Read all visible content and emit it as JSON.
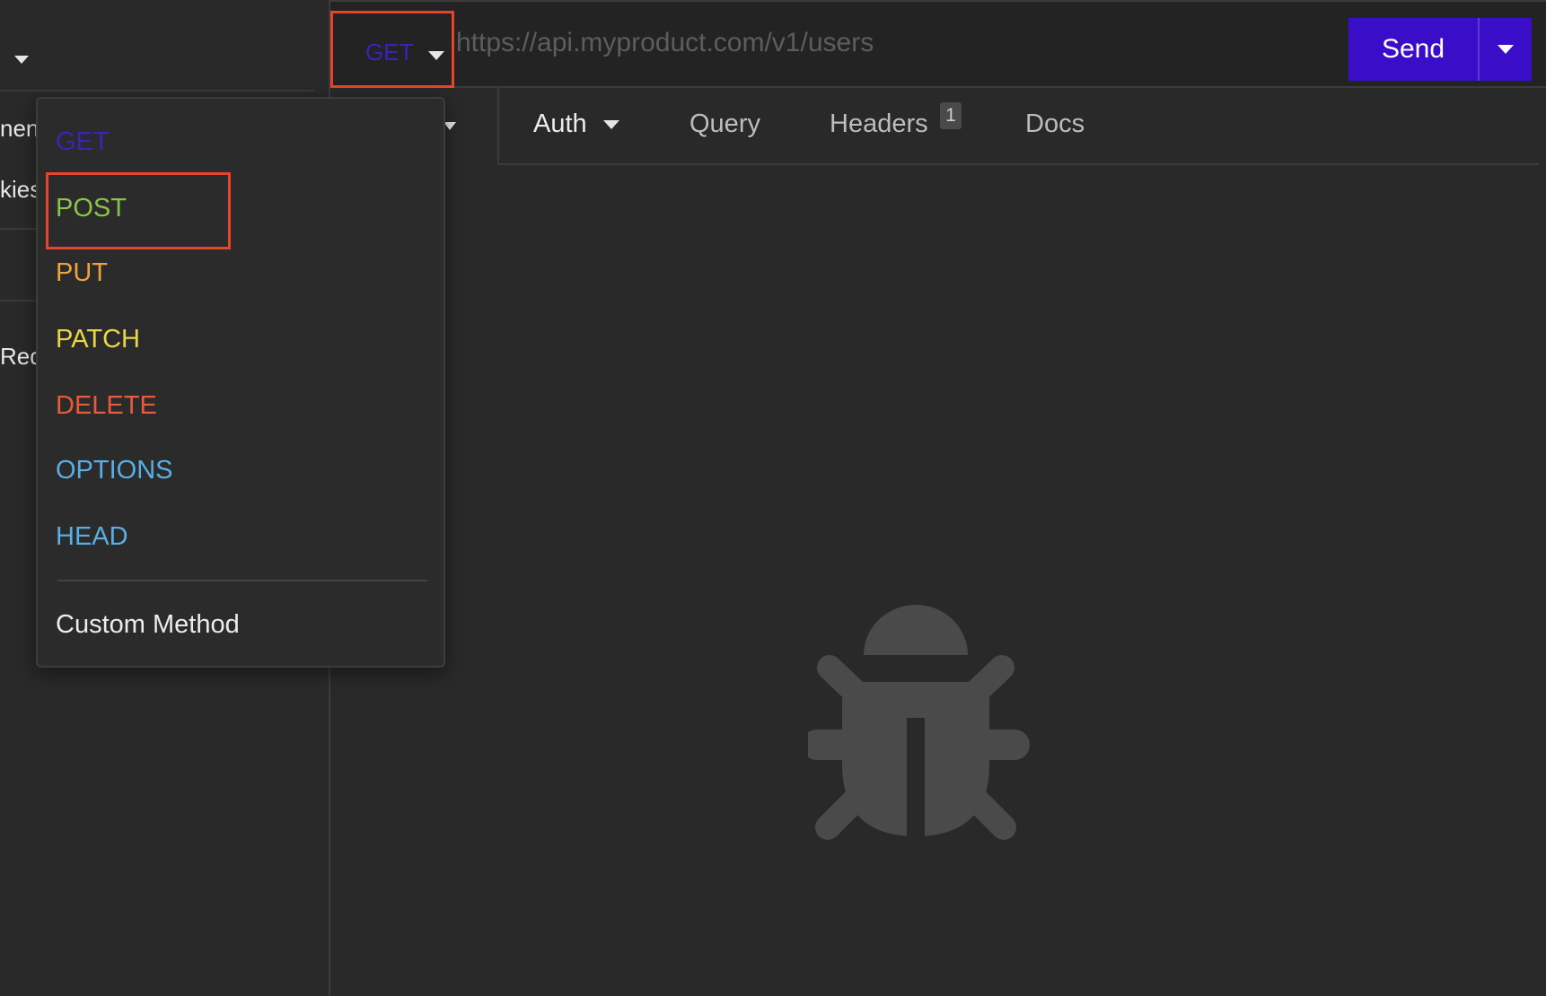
{
  "sidebar": {
    "fragments": [
      "nen",
      "kies",
      "Req"
    ]
  },
  "topbar": {
    "method": "GET",
    "url_placeholder": "https://api.myproduct.com/v1/users",
    "send_label": "Send"
  },
  "tabs": {
    "auth": "Auth",
    "query": "Query",
    "headers": "Headers",
    "headers_count": "1",
    "docs": "Docs"
  },
  "method_menu": {
    "items": [
      {
        "label": "GET",
        "color": "#3c22b6"
      },
      {
        "label": "POST",
        "color": "#8bc34a"
      },
      {
        "label": "PUT",
        "color": "#f0a03c"
      },
      {
        "label": "PATCH",
        "color": "#e9d74a"
      },
      {
        "label": "DELETE",
        "color": "#e85a3a"
      },
      {
        "label": "OPTIONS",
        "color": "#5aaee6"
      },
      {
        "label": "HEAD",
        "color": "#5aaee6"
      }
    ],
    "custom_method": "Custom Method"
  },
  "colors": {
    "accent": "#3a0dc8",
    "highlight": "#e8432d",
    "icon_gray": "#4a4a4a"
  },
  "icons": {
    "empty_state": "bug-icon"
  }
}
